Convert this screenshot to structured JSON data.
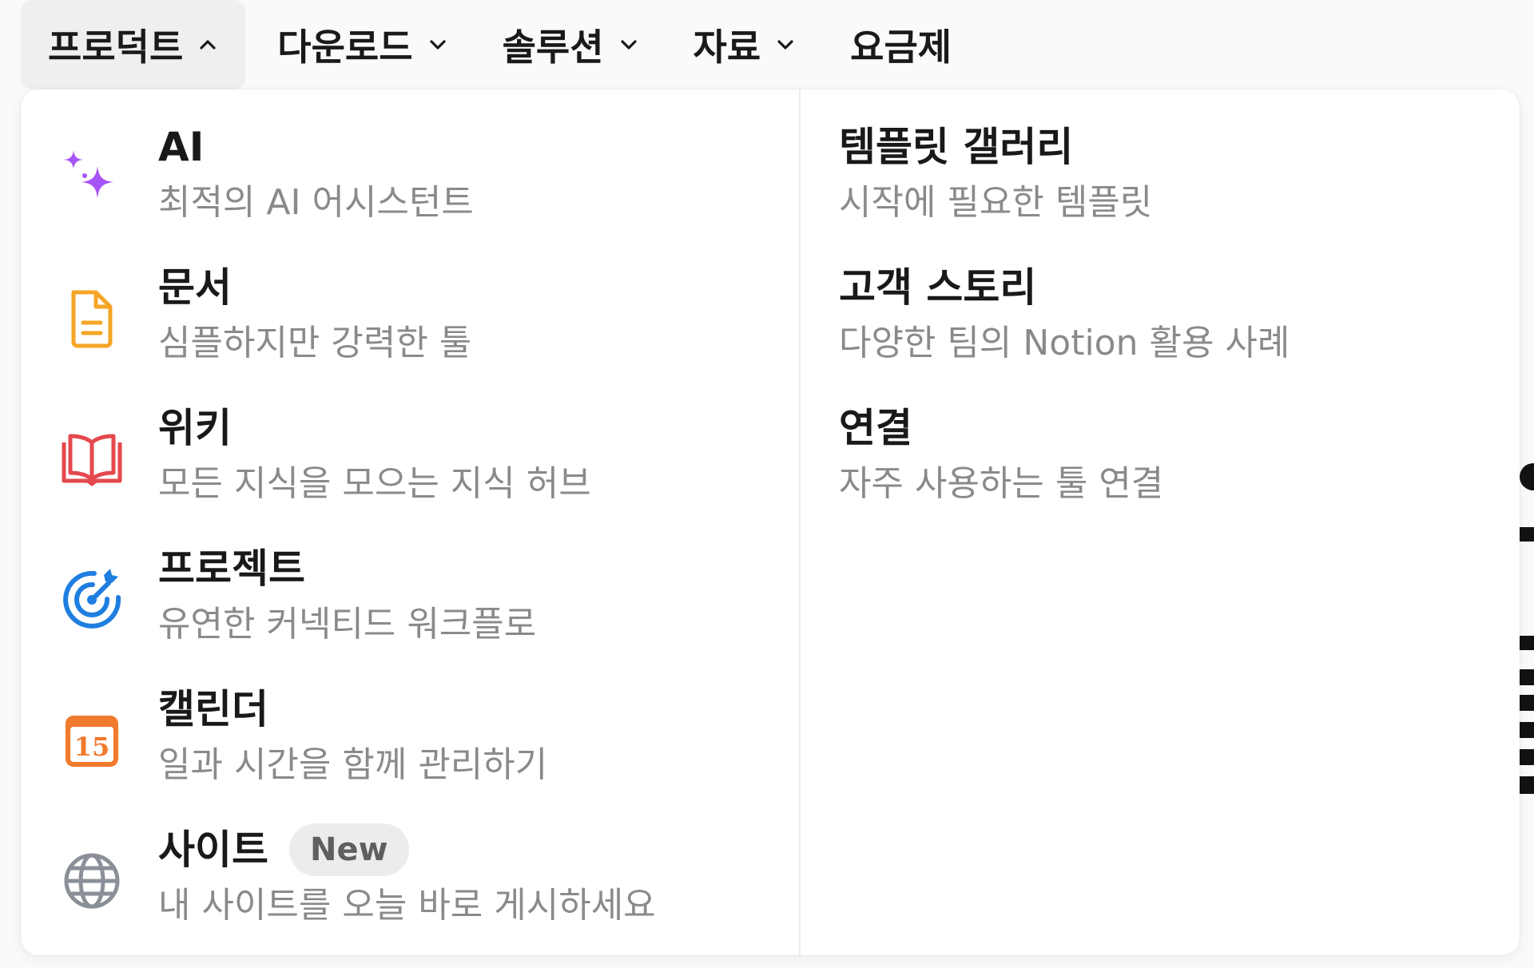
{
  "nav": {
    "items": [
      {
        "label": "프로덕트",
        "chevron": "chevron-up-icon",
        "active": true
      },
      {
        "label": "다운로드",
        "chevron": "chevron-down-icon",
        "active": false
      },
      {
        "label": "솔루션",
        "chevron": "chevron-down-icon",
        "active": false
      },
      {
        "label": "자료",
        "chevron": "chevron-down-icon",
        "active": false
      },
      {
        "label": "요금제",
        "chevron": null,
        "active": false
      }
    ]
  },
  "dropdown": {
    "left": [
      {
        "title": "AI",
        "desc": "최적의 AI 어시스턴트",
        "icon": "sparkles-icon",
        "color": "#a855f7"
      },
      {
        "title": "문서",
        "desc": "심플하지만 강력한 툴",
        "icon": "document-icon",
        "color": "#f5a524"
      },
      {
        "title": "위키",
        "desc": "모든 지식을 모으는 지식 허브",
        "icon": "book-icon",
        "color": "#e5484d"
      },
      {
        "title": "프로젝트",
        "desc": "유연한 커넥티드 워크플로",
        "icon": "target-icon",
        "color": "#1f7ee0"
      },
      {
        "title": "캘린더",
        "desc": "일과 시간을 함께 관리하기",
        "icon": "calendar-icon",
        "color": "#f07a2d",
        "icon_text": "15"
      },
      {
        "title": "사이트",
        "desc": "내 사이트를 오늘 바로 게시하세요",
        "icon": "globe-icon",
        "color": "#8a8f98",
        "badge": "New"
      }
    ],
    "right": [
      {
        "title": "템플릿 갤러리",
        "desc": "시작에 필요한 템플릿"
      },
      {
        "title": "고객 스토리",
        "desc": "다양한 팀의 Notion 활용 사례"
      },
      {
        "title": "연결",
        "desc": "자주 사용하는 툴 연결"
      }
    ]
  }
}
